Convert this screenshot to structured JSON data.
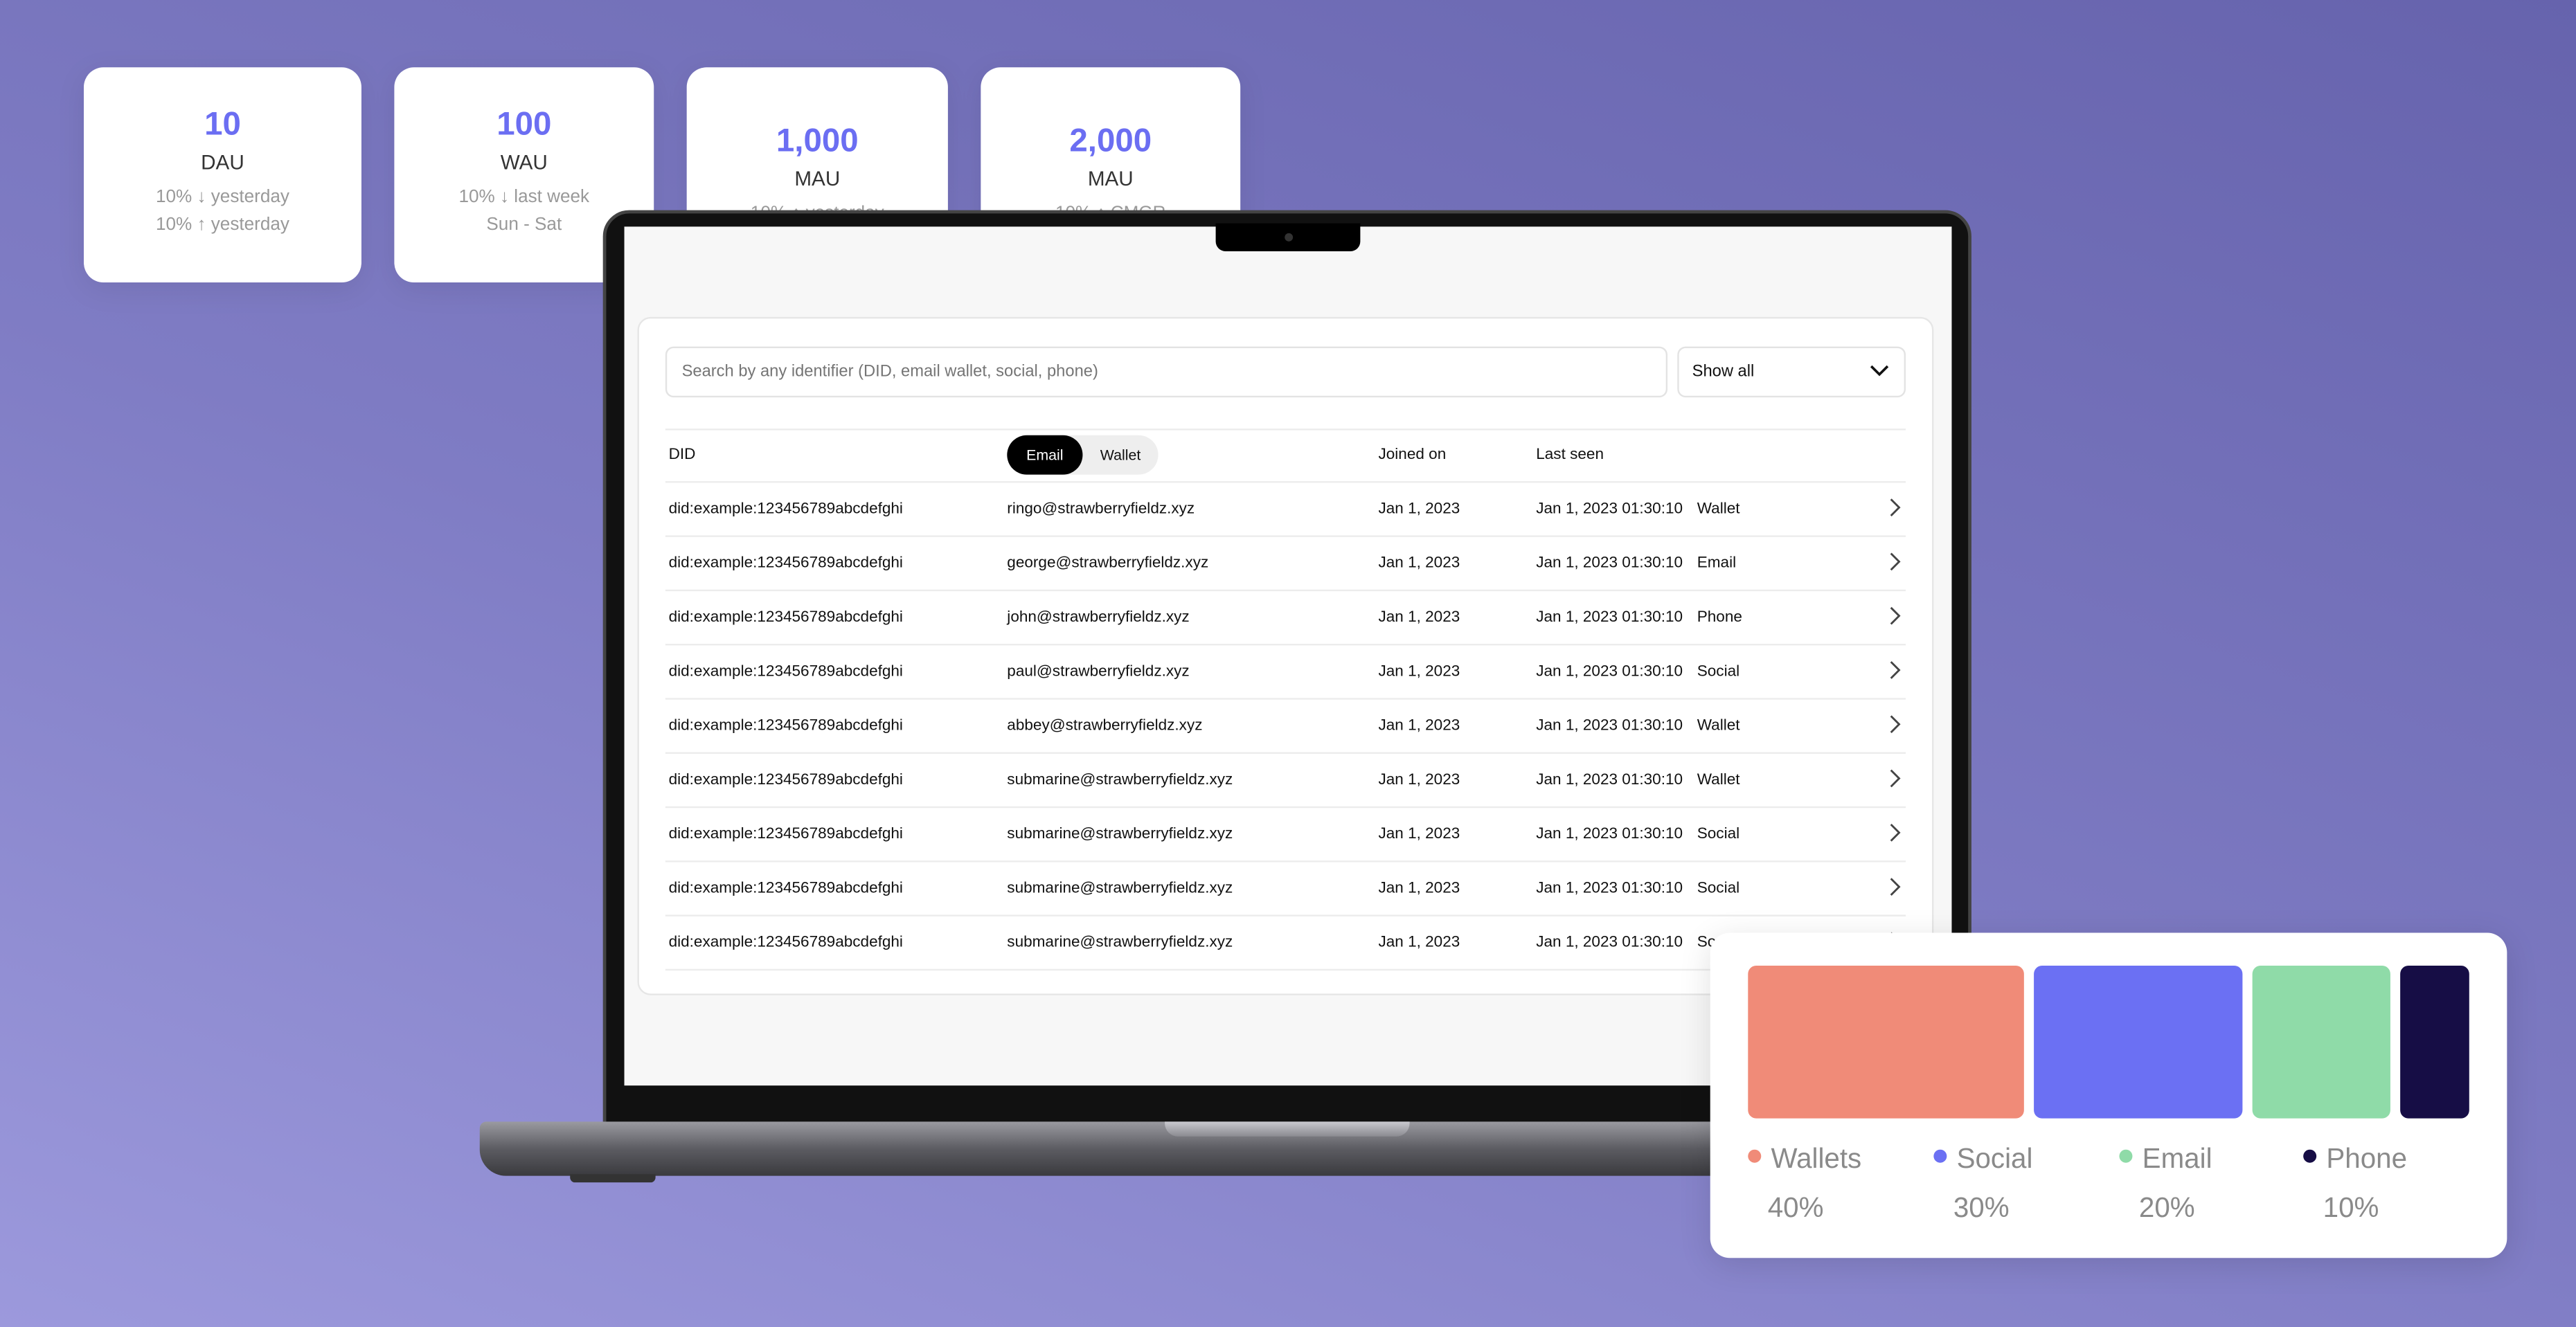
{
  "stats": [
    {
      "value": "10",
      "label": "DAU",
      "lines": [
        "10% ↓ yesterday",
        "10% ↑ yesterday"
      ]
    },
    {
      "value": "100",
      "label": "WAU",
      "lines": [
        "10% ↓ last week",
        "Sun - Sat"
      ]
    },
    {
      "value": "1,000",
      "label": "MAU",
      "lines": [
        "10% ↑ yesterday"
      ]
    },
    {
      "value": "2,000",
      "label": "MAU",
      "lines": [
        "10% ↑ CMGR"
      ]
    }
  ],
  "search": {
    "placeholder": "Search by any identifier (DID, email wallet, social, phone)"
  },
  "filter": {
    "selected": "Show all"
  },
  "table": {
    "headers": {
      "did": "DID",
      "joined": "Joined on",
      "last_seen": "Last seen"
    },
    "toggle": {
      "active": "Email",
      "inactive": "Wallet"
    },
    "rows": [
      {
        "did": "did:example:123456789abcdefghi",
        "email": "ringo@strawberryfieldz.xyz",
        "joined": "Jan 1, 2023",
        "last_seen": "Jan 1, 2023 01:30:10",
        "type": "Wallet"
      },
      {
        "did": "did:example:123456789abcdefghi",
        "email": "george@strawberryfieldz.xyz",
        "joined": "Jan 1, 2023",
        "last_seen": "Jan 1, 2023 01:30:10",
        "type": "Email"
      },
      {
        "did": "did:example:123456789abcdefghi",
        "email": "john@strawberryfieldz.xyz",
        "joined": "Jan 1, 2023",
        "last_seen": "Jan 1, 2023 01:30:10",
        "type": "Phone"
      },
      {
        "did": "did:example:123456789abcdefghi",
        "email": "paul@strawberryfieldz.xyz",
        "joined": "Jan 1, 2023",
        "last_seen": "Jan 1, 2023 01:30:10",
        "type": "Social"
      },
      {
        "did": "did:example:123456789abcdefghi",
        "email": "abbey@strawberryfieldz.xyz",
        "joined": "Jan 1, 2023",
        "last_seen": "Jan 1, 2023 01:30:10",
        "type": "Wallet"
      },
      {
        "did": "did:example:123456789abcdefghi",
        "email": "submarine@strawberryfieldz.xyz",
        "joined": "Jan 1, 2023",
        "last_seen": "Jan 1, 2023 01:30:10",
        "type": "Wallet"
      },
      {
        "did": "did:example:123456789abcdefghi",
        "email": "submarine@strawberryfieldz.xyz",
        "joined": "Jan 1, 2023",
        "last_seen": "Jan 1, 2023 01:30:10",
        "type": "Social"
      },
      {
        "did": "did:example:123456789abcdefghi",
        "email": "submarine@strawberryfieldz.xyz",
        "joined": "Jan 1, 2023",
        "last_seen": "Jan 1, 2023 01:30:10",
        "type": "Social"
      },
      {
        "did": "did:example:123456789abcdefghi",
        "email": "submarine@strawberryfieldz.xyz",
        "joined": "Jan 1, 2023",
        "last_seen": "Jan 1, 2023 01:30:10",
        "type": "Social"
      }
    ]
  },
  "chart_data": {
    "type": "bar",
    "categories": [
      "Wallets",
      "Social",
      "Email",
      "Phone"
    ],
    "values": [
      40,
      30,
      20,
      10
    ],
    "labels": [
      "40%",
      "30%",
      "20%",
      "10%"
    ],
    "colors": [
      "#f08b78",
      "#6b70f3",
      "#8fdba8",
      "#160d45"
    ],
    "legend": "bottom"
  }
}
